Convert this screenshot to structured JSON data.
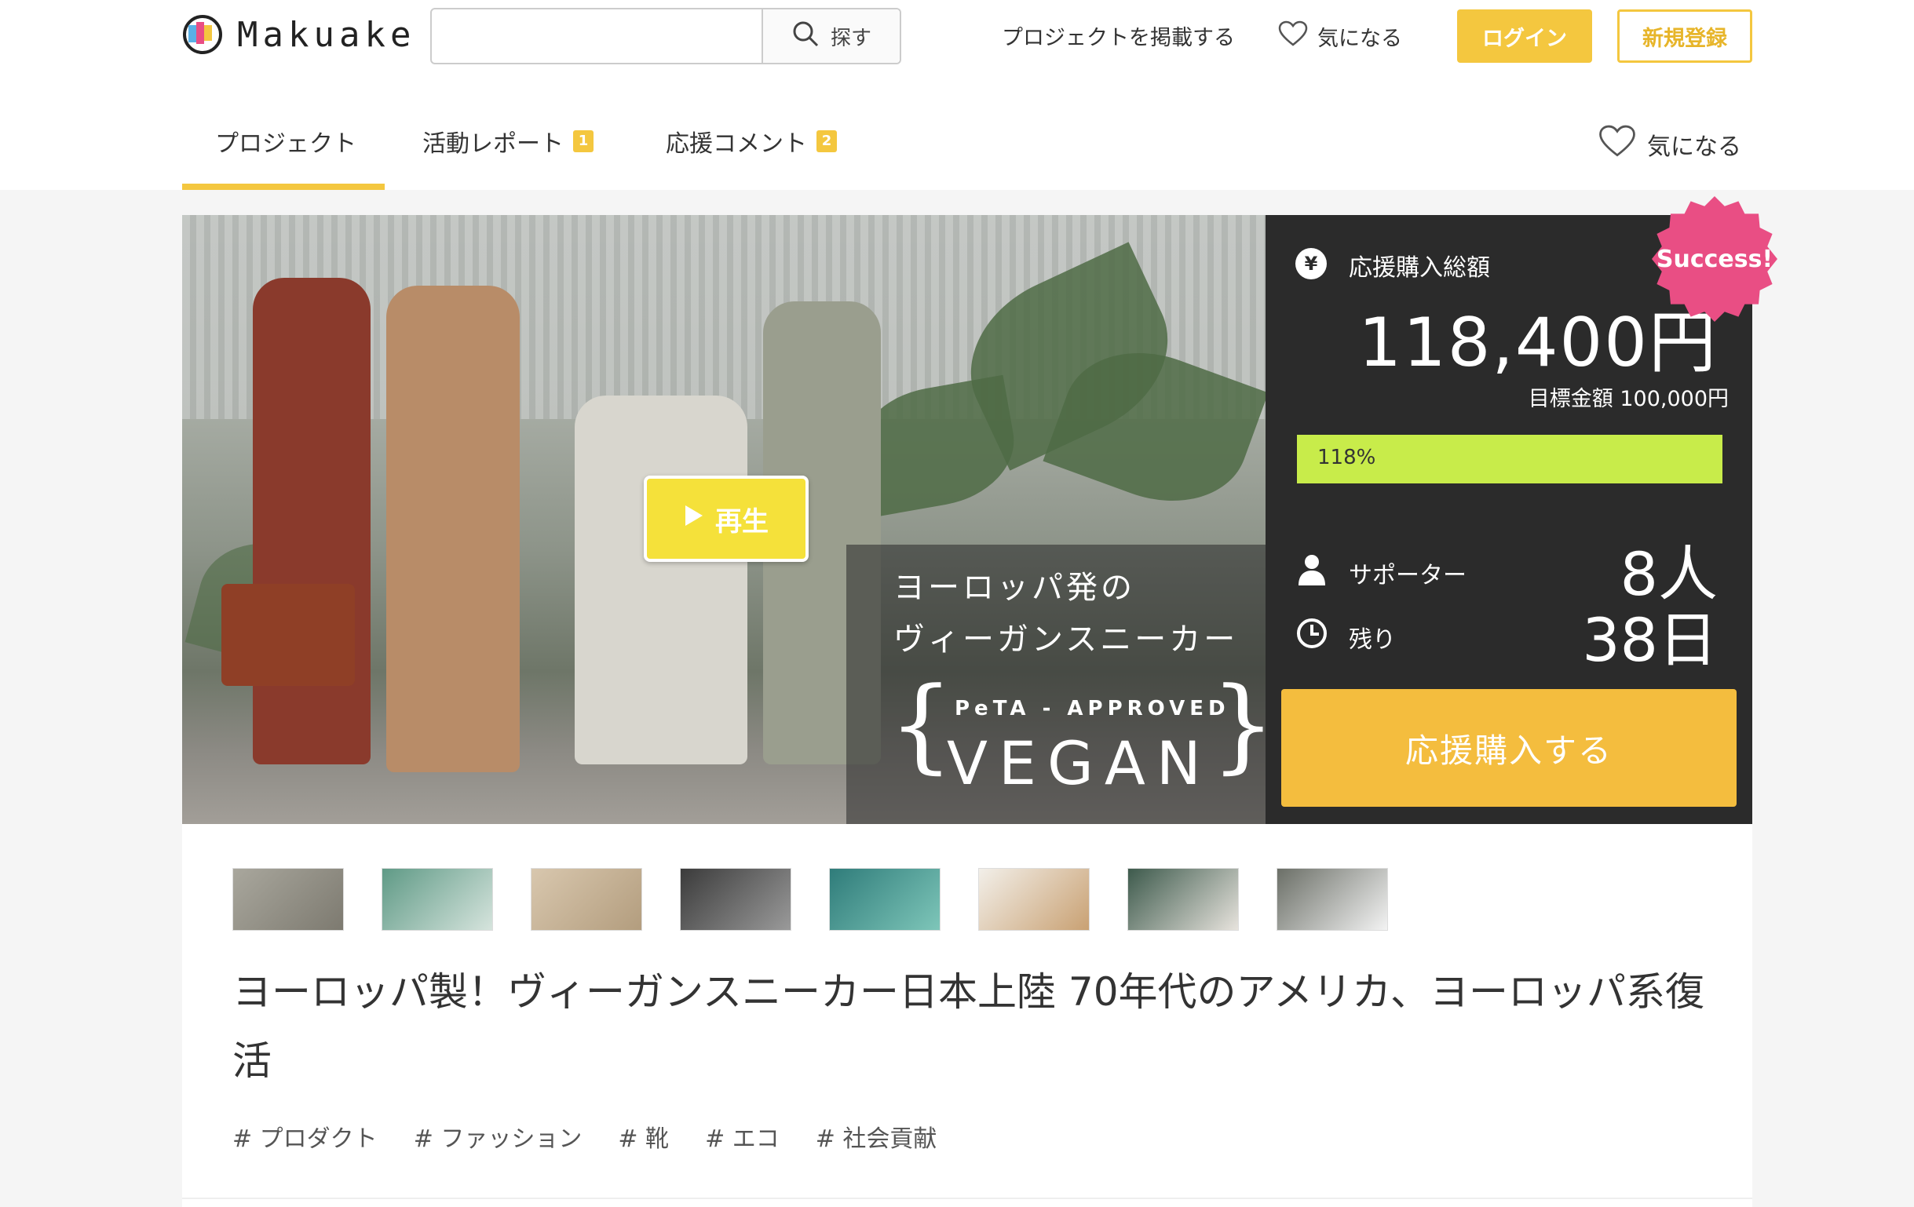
{
  "header": {
    "logo_text": "Makuake",
    "search": {
      "value": "",
      "placeholder": "",
      "button_label": "探す"
    },
    "nav_post_project": "プロジェクトを掲載する",
    "nav_favorite": "気になる",
    "login_label": "ログイン",
    "register_label": "新規登録",
    "colors": {
      "accent": "#f4c73f"
    }
  },
  "tabs": [
    {
      "label": "プロジェクト",
      "badge": ""
    },
    {
      "label": "活動レポート",
      "badge": "1"
    },
    {
      "label": "応援コメント",
      "badge": "2"
    }
  ],
  "tab_favorite": "気になる",
  "hero": {
    "play_label": "再生",
    "overlay_line1": "ヨーロッパ発の",
    "overlay_line2": "ヴィーガンスニーカー",
    "peta_text": "PeTA - APPROVED",
    "vegan_text": "VEGAN"
  },
  "funding": {
    "total_label": "応援購入総額",
    "amount": "118,400円",
    "goal": "目標金額 100,000円",
    "progress_percent": 118,
    "progress_label": "118%",
    "supporters_label": "サポーター",
    "supporters_value": "8人",
    "remaining_label": "残り",
    "remaining_value": "38日",
    "buy_label": "応援購入する",
    "success_badge": "Success!",
    "colors": {
      "progress": "#c8ec4a",
      "buy": "#f4bd3e",
      "badge": "#e94e84",
      "panel": "#2b2b2b"
    }
  },
  "thumbnails": 8,
  "title": "ヨーロッパ製！ヴィーガンスニーカー日本上陸 70年代のアメリカ、ヨーロッパ系復活",
  "tags": [
    "# プロダクト",
    "# ファッション",
    "# 靴",
    "# エコ",
    "# 社会貢献"
  ]
}
